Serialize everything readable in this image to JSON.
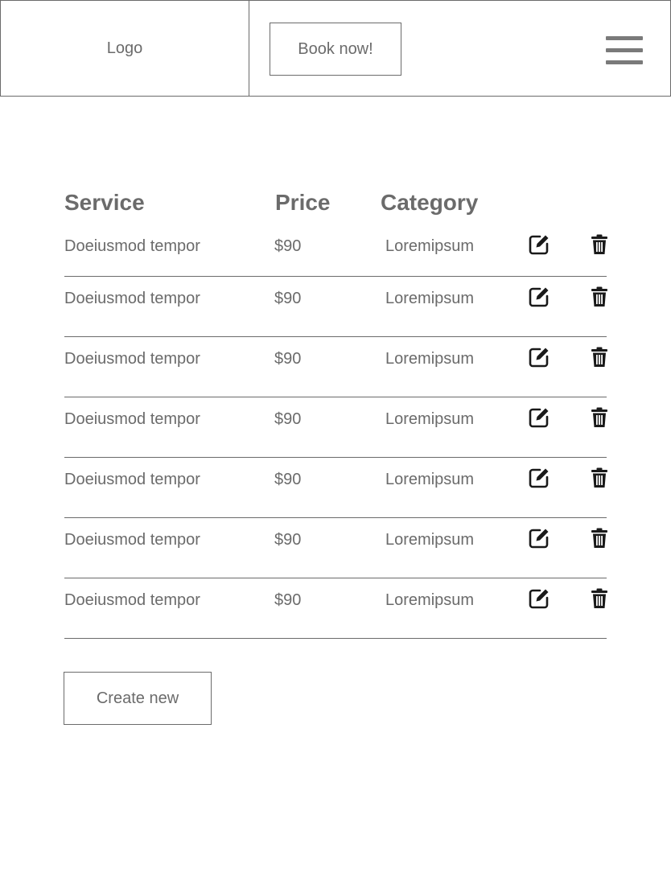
{
  "header": {
    "logo_text": "Logo",
    "book_label": "Book now!",
    "menu_icon": "hamburger-menu-icon"
  },
  "table": {
    "columns": [
      "Service",
      "Price",
      "Category"
    ],
    "rows": [
      {
        "service": "Doeiusmod tempor",
        "price": "$90",
        "category": "Loremipsum"
      },
      {
        "service": "Doeiusmod tempor",
        "price": "$90",
        "category": "Loremipsum"
      },
      {
        "service": "Doeiusmod tempor",
        "price": "$90",
        "category": "Loremipsum"
      },
      {
        "service": "Doeiusmod tempor",
        "price": "$90",
        "category": "Loremipsum"
      },
      {
        "service": "Doeiusmod tempor",
        "price": "$90",
        "category": "Loremipsum"
      },
      {
        "service": "Doeiusmod tempor",
        "price": "$90",
        "category": "Loremipsum"
      },
      {
        "service": "Doeiusmod tempor",
        "price": "$90",
        "category": "Loremipsum"
      }
    ],
    "row_icons": {
      "edit": "edit-icon",
      "delete": "trash-icon"
    }
  },
  "actions": {
    "create_label": "Create new"
  },
  "colors": {
    "text": "#6b6b6b",
    "border": "#6b6b6b",
    "icon": "#1a1a1a"
  }
}
